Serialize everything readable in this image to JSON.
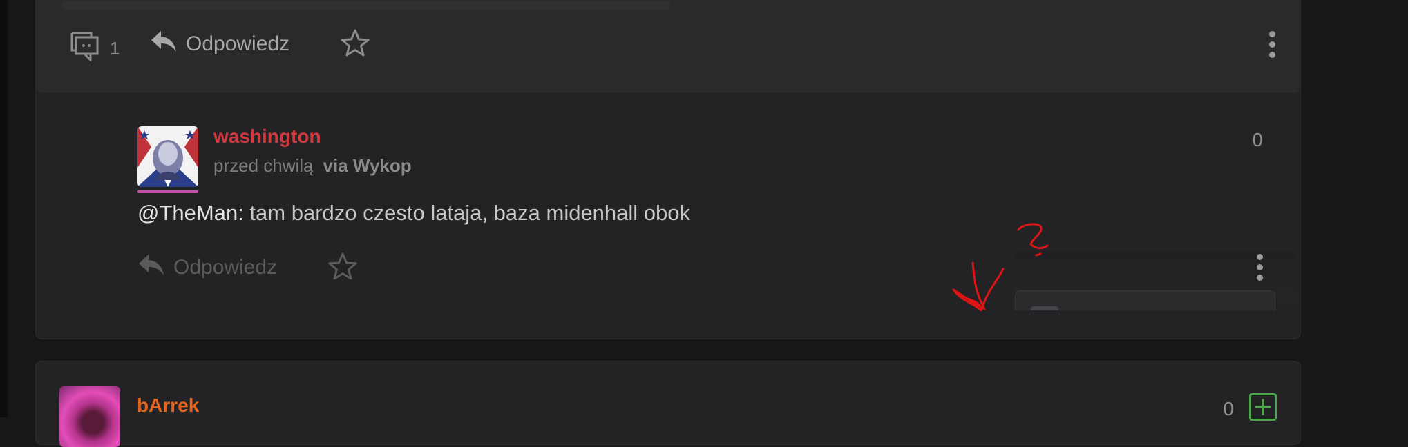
{
  "thread": {
    "comment_count": "1",
    "reply_label": "Odpowiedz"
  },
  "comment": {
    "username": "washington",
    "time": "przed chwilą",
    "via": "via Wykop",
    "score": "0",
    "mention": "@TheMan:",
    "text": " tam bardzo czesto lataja, baza midenhall obok",
    "reply_label": "Odpowiedz"
  },
  "next_entry": {
    "username": "bArrek",
    "score": "0"
  },
  "icons": [
    "comments-icon",
    "reply-icon",
    "star-icon",
    "more-vert-icon",
    "plus-icon"
  ],
  "colors": {
    "username_red": "#d0393e",
    "username_orange": "#e5631d",
    "accent_pink": "#c84fa9",
    "plus_green": "#4ea64d",
    "annotation_red": "#e01414"
  }
}
